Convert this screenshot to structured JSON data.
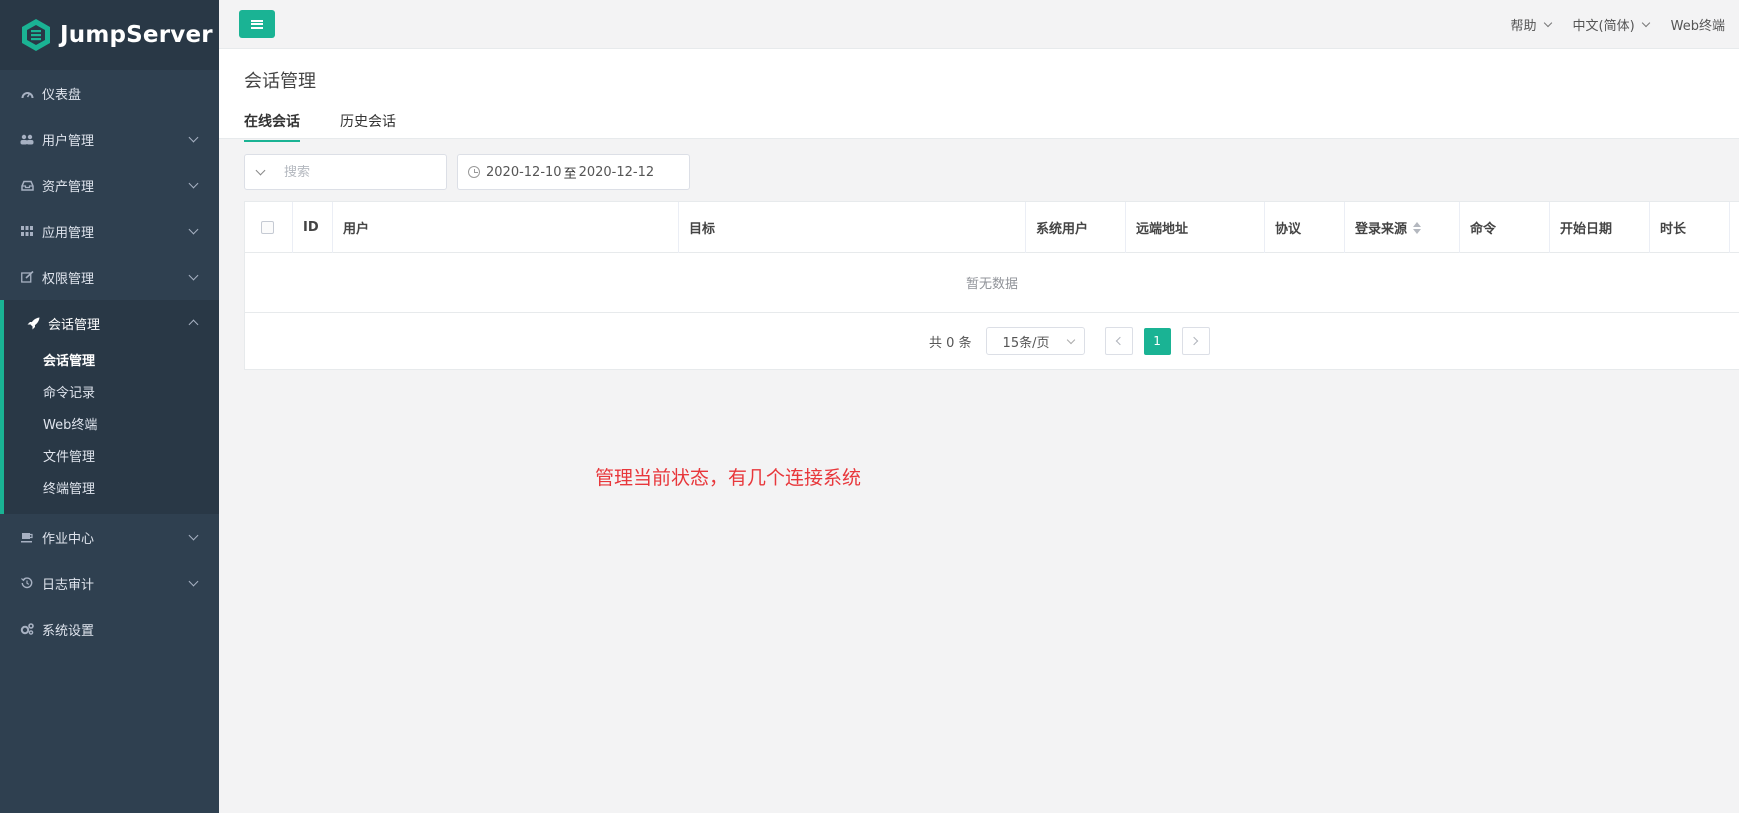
{
  "brand": {
    "name": "JumpServer",
    "accent": "#1ab394",
    "sidebar_bg": "#2f4050"
  },
  "sidebar": {
    "items": [
      {
        "label": "仪表盘",
        "icon": "dashboard-icon"
      },
      {
        "label": "用户管理",
        "icon": "users-icon"
      },
      {
        "label": "资产管理",
        "icon": "inbox-icon"
      },
      {
        "label": "应用管理",
        "icon": "grid-icon"
      },
      {
        "label": "权限管理",
        "icon": "edit-icon"
      },
      {
        "label": "会话管理",
        "icon": "rocket-icon",
        "expanded": true,
        "children": [
          "会话管理",
          "命令记录",
          "Web终端",
          "文件管理",
          "终端管理"
        ]
      },
      {
        "label": "作业中心",
        "icon": "coffee-icon"
      },
      {
        "label": "日志审计",
        "icon": "history-icon"
      },
      {
        "label": "系统设置",
        "icon": "gears-icon"
      }
    ]
  },
  "topbar": {
    "help": "帮助",
    "language": "中文(简体)",
    "web_terminal": "Web终端"
  },
  "page": {
    "title": "会话管理",
    "tabs": [
      {
        "label": "在线会话",
        "active": true
      },
      {
        "label": "历史会话",
        "active": false
      }
    ]
  },
  "filters": {
    "search_placeholder": "搜索",
    "date_start": "2020-12-10",
    "date_sep": "至",
    "date_end": "2020-12-12"
  },
  "table": {
    "columns": [
      "ID",
      "用户",
      "目标",
      "系统用户",
      "远端地址",
      "协议",
      "登录来源",
      "命令",
      "开始日期",
      "时长"
    ],
    "empty_text": "暂无数据"
  },
  "pagination": {
    "total_text": "共 0 条",
    "page_size": "15条/页",
    "current_page": "1"
  },
  "annotation": "管理当前状态，有几个连接系统"
}
